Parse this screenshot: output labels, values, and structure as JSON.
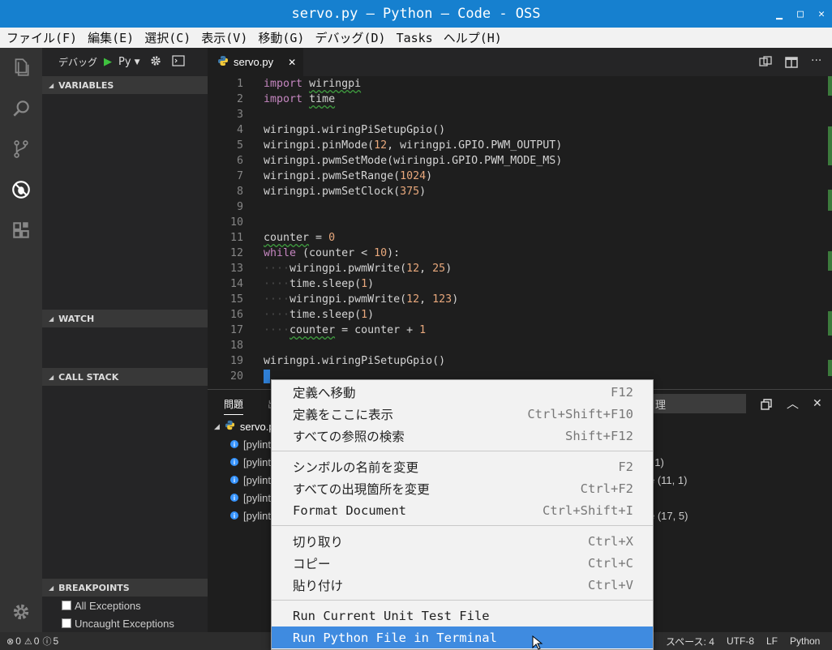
{
  "window": {
    "title": "servo.py — Python — Code - OSS",
    "min": "▁",
    "max": "□",
    "close": "✕"
  },
  "menu": [
    "ファイル(F)",
    "編集(E)",
    "選択(C)",
    "表示(V)",
    "移動(G)",
    "デバッグ(D)",
    "Tasks",
    "ヘルプ(H)"
  ],
  "debug": {
    "label": "デバッグ",
    "config": "Py"
  },
  "sidebar": {
    "variables": "VARIABLES",
    "watch": "WATCH",
    "callstack": "CALL STACK",
    "breakpoints": "BREAKPOINTS",
    "bp_items": [
      "All Exceptions",
      "Uncaught Exceptions"
    ]
  },
  "tab": {
    "filename": "servo.py",
    "close": "✕"
  },
  "editor": {
    "lines": [
      "import wiringpi",
      "import time",
      "",
      "wiringpi.wiringPiSetupGpio()",
      "wiringpi.pinMode(12, wiringpi.GPIO.PWM_OUTPUT)",
      "wiringpi.pwmSetMode(wiringpi.GPIO.PWM_MODE_MS)",
      "wiringpi.pwmSetRange(1024)",
      "wiringpi.pwmSetClock(375)",
      "",
      "",
      "counter = 0",
      "while (counter < 10):",
      "    wiringpi.pwmWrite(12, 25)",
      "    time.sleep(1)",
      "    wiringpi.pwmWrite(12, 123)",
      "    time.sleep(1)",
      "    counter = counter + 1",
      "",
      "wiringpi.wiringPiSetupGpio()",
      ""
    ]
  },
  "panel": {
    "tab_problems": "問題",
    "tab_partial": "出",
    "filter_partial": "理",
    "file": "servo.p",
    "rows": [
      {
        "text": "[pylint",
        "suffix": "",
        "trail": ""
      },
      {
        "text": "[pylint",
        "suffix": ", 1)",
        "trail": ""
      },
      {
        "text": "[pylint",
        "suffix": "e (11, 1)",
        "trail": ""
      },
      {
        "text": "[pylint",
        "suffix": "",
        "trail": ""
      },
      {
        "text": "[pylint",
        "suffix": "e (17, 5)",
        "trail": ""
      }
    ]
  },
  "contextmenu": {
    "groups": [
      [
        {
          "label": "定義へ移動",
          "shortcut": "F12"
        },
        {
          "label": "定義をここに表示",
          "shortcut": "Ctrl+Shift+F10"
        },
        {
          "label": "すべての参照の検索",
          "shortcut": "Shift+F12"
        }
      ],
      [
        {
          "label": "シンボルの名前を変更",
          "shortcut": "F2"
        },
        {
          "label": "すべての出現箇所を変更",
          "shortcut": "Ctrl+F2"
        },
        {
          "label": "Format Document",
          "shortcut": "Ctrl+Shift+I"
        }
      ],
      [
        {
          "label": "切り取り",
          "shortcut": "Ctrl+X"
        },
        {
          "label": "コピー",
          "shortcut": "Ctrl+C"
        },
        {
          "label": "貼り付け",
          "shortcut": "Ctrl+V"
        }
      ],
      [
        {
          "label": "Run Current Unit Test File",
          "shortcut": ""
        },
        {
          "label": "Run Python File in Terminal",
          "shortcut": ""
        }
      ]
    ]
  },
  "status": {
    "errors": "0",
    "warnings": "0",
    "infos": "5",
    "spaces": "スペース: 4",
    "encoding": "UTF-8",
    "eol": "LF",
    "language": "Python"
  }
}
